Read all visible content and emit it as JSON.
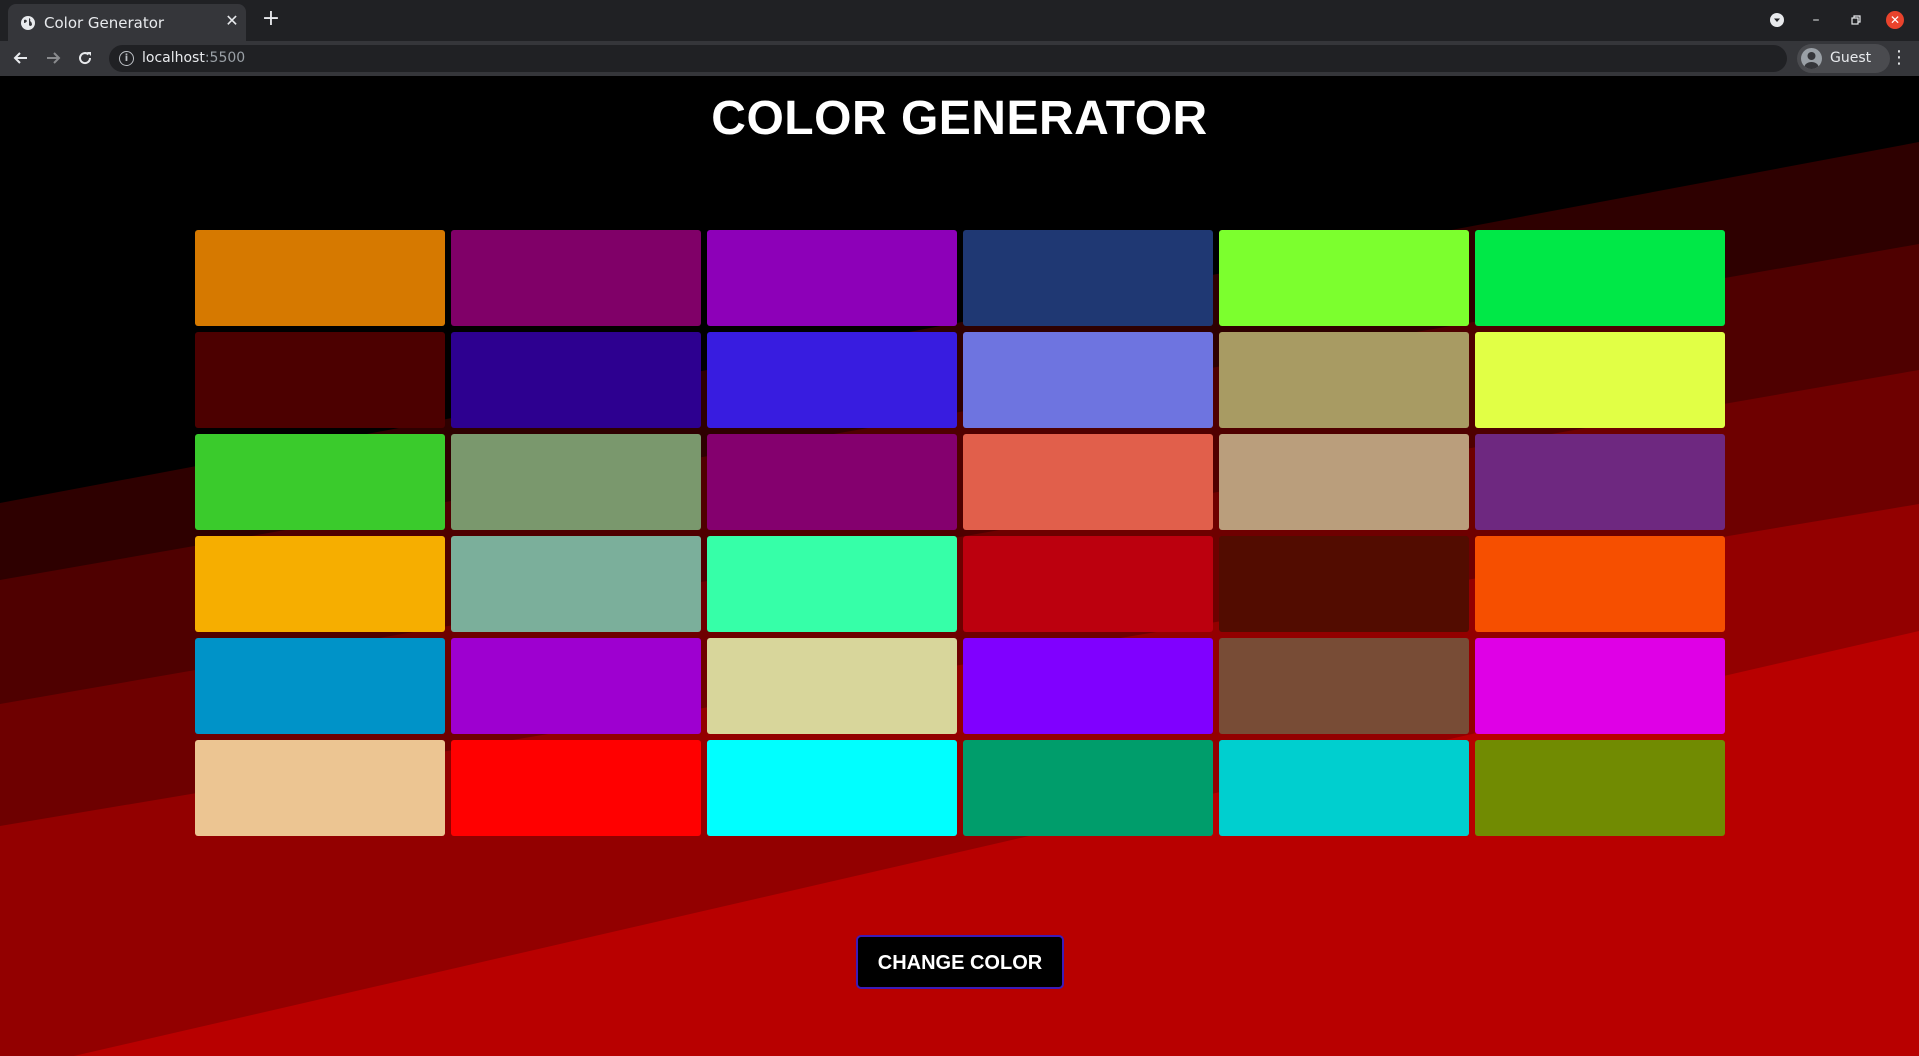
{
  "browser": {
    "tab_title": "Color Generator",
    "url_host": "localhost",
    "url_port": ":5500",
    "profile_name": "Guest"
  },
  "page": {
    "title": "COLOR GENERATOR",
    "button_label": "CHANGE COLOR"
  },
  "background_bands": [
    "#000000",
    "#2e0000",
    "#4f0000",
    "#6e0000",
    "#930000",
    "#b80000"
  ],
  "swatches": [
    "#d67900",
    "#800068",
    "#8d00b8",
    "#1f3873",
    "#7cff2e",
    "#00e847",
    "#4c0000",
    "#2d0090",
    "#381ce0",
    "#6e74e0",
    "#a89b63",
    "#e1ff45",
    "#3acb2c",
    "#7a986d",
    "#84006e",
    "#e15f4b",
    "#ba9e7c",
    "#6e2880",
    "#f6ae00",
    "#7baf9b",
    "#36ffa8",
    "#bc000e",
    "#520c00",
    "#f64f00",
    "#0093c8",
    "#9e00d0",
    "#d8d69b",
    "#8000ff",
    "#784c36",
    "#df00e6",
    "#ecc592",
    "#ff0000",
    "#00ffff",
    "#009d6b",
    "#00cfcf",
    "#718b02"
  ]
}
